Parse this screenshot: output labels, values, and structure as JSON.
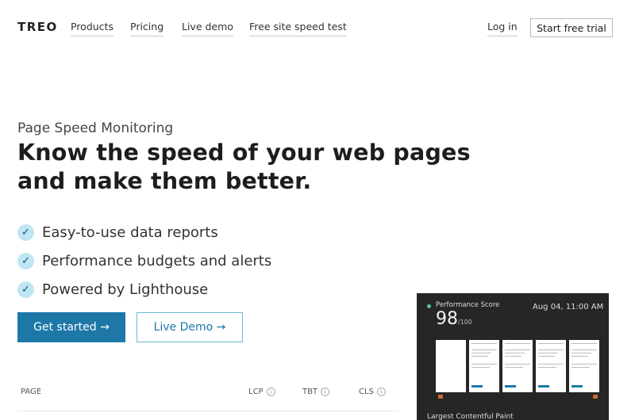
{
  "header": {
    "logo": "TREO",
    "nav": [
      "Products",
      "Pricing",
      "Live demo",
      "Free site speed test"
    ],
    "login": "Log in",
    "trial_button": "Start free trial"
  },
  "hero": {
    "eyebrow": "Page Speed Monitoring",
    "headline_line1": "Know the speed of your web pages",
    "headline_line2": "and make them better.",
    "features": [
      "Easy-to-use data reports",
      "Performance budgets and alerts",
      "Powered by Lighthouse"
    ],
    "check_glyph": "✓",
    "primary_button": "Get started →",
    "secondary_button": "Live Demo →"
  },
  "table": {
    "headers": [
      "PAGE",
      "LCP",
      "TBT",
      "CLS"
    ],
    "info_glyph": "i"
  },
  "panel": {
    "label": "Performance Score",
    "date": "Aug 04, 11:00 AM",
    "score": "98",
    "score_max": "/100",
    "sub_label": "Largest Contentful Paint"
  },
  "colors": {
    "primary": "#1d78a8",
    "check_bg": "#bfe6f3",
    "panel_bg": "#262626",
    "status_dot": "#4fc3a1",
    "marker": "#c96a3a"
  }
}
